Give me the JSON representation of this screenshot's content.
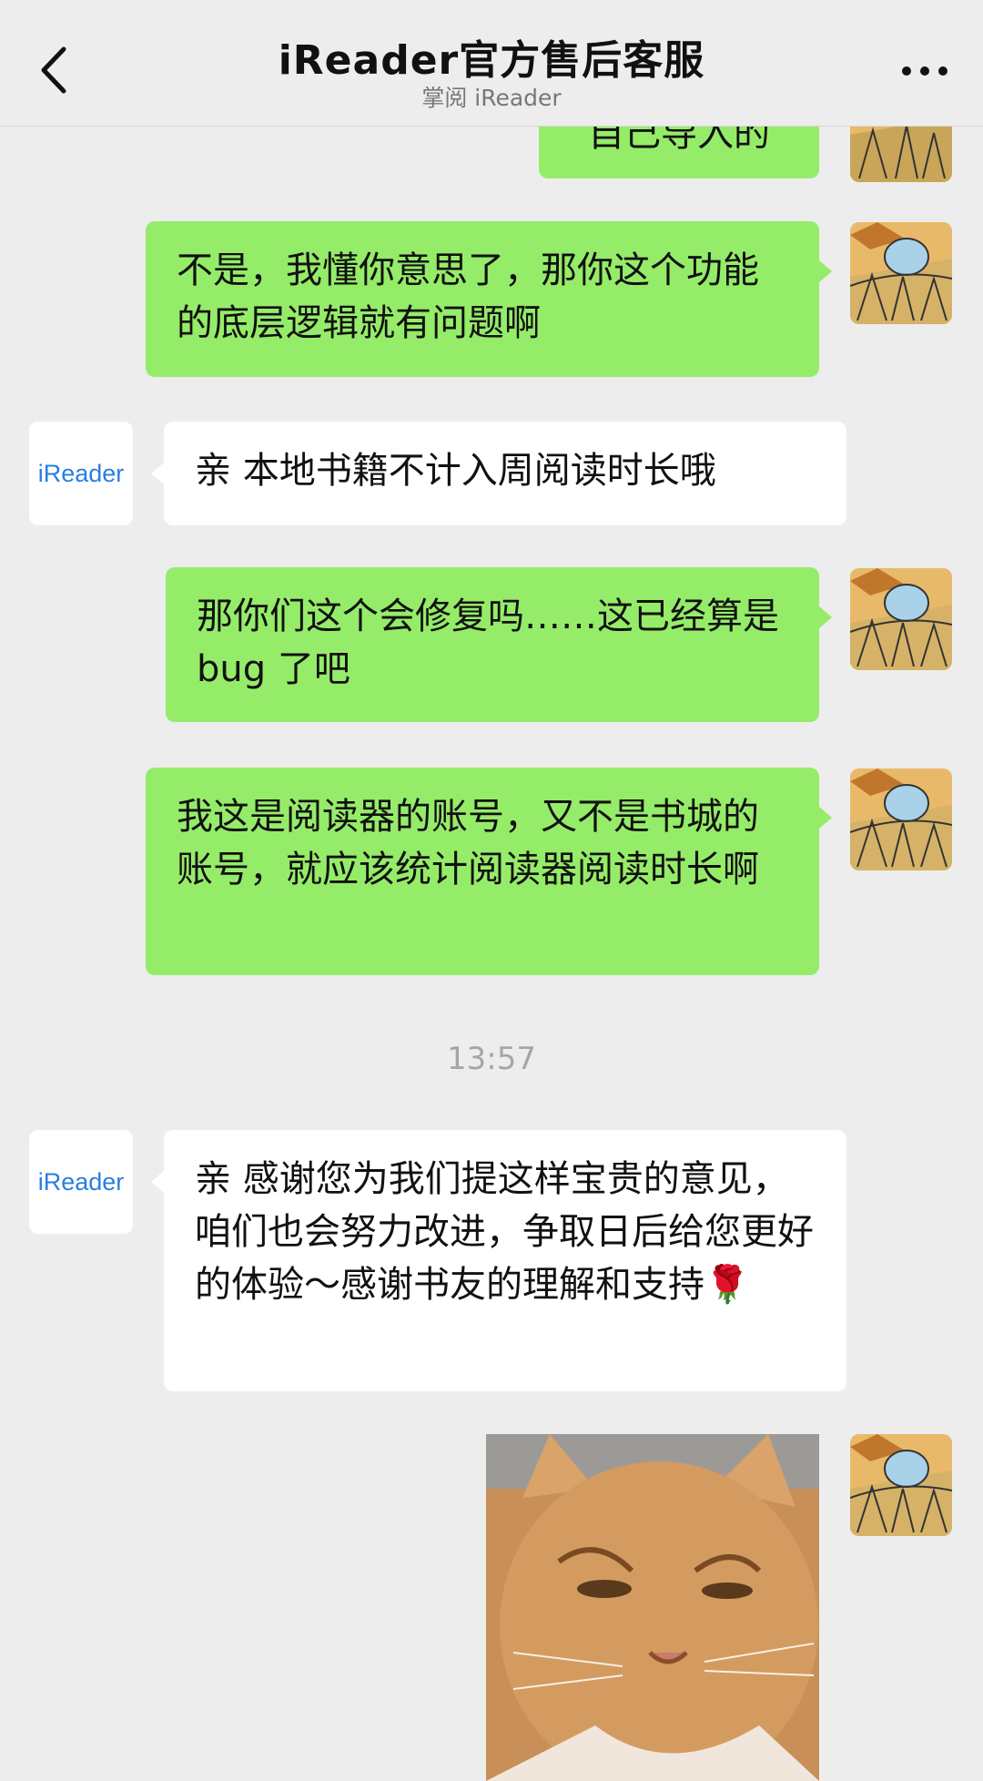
{
  "header": {
    "title": "iReader官方售后客服",
    "subtitle": "掌阅 iReader",
    "back_icon": "chevron-left-icon",
    "more_icon": "more-dots-icon"
  },
  "messages": [
    {
      "sender": "user",
      "text": "自己导入的"
    },
    {
      "sender": "user",
      "text": "不是，我懂你意思了，那你这个功能的底层逻辑就有问题啊"
    },
    {
      "sender": "service",
      "text": "亲 本地书籍不计入周阅读时长哦"
    },
    {
      "sender": "user",
      "text": "那你们这个会修复吗……这已经算是 bug 了吧"
    },
    {
      "sender": "user",
      "text": "我这是阅读器的账号，又不是书城的账号，就应该统计阅读器阅读时长啊"
    },
    {
      "sender": "service",
      "text": "亲 感谢您为我们提这样宝贵的意见，咱们也会努力改进，争取日后给您更好的体验～感谢书友的理解和支持🌹"
    },
    {
      "sender": "user",
      "type": "image",
      "image": "orange-cat-sticker"
    }
  ],
  "timestamp": "13:57",
  "service_avatar_text": "iReader",
  "colors": {
    "background": "#ededed",
    "user_bubble": "#95ec69",
    "service_bubble": "#ffffff",
    "brand_blue": "#2a7de1"
  }
}
